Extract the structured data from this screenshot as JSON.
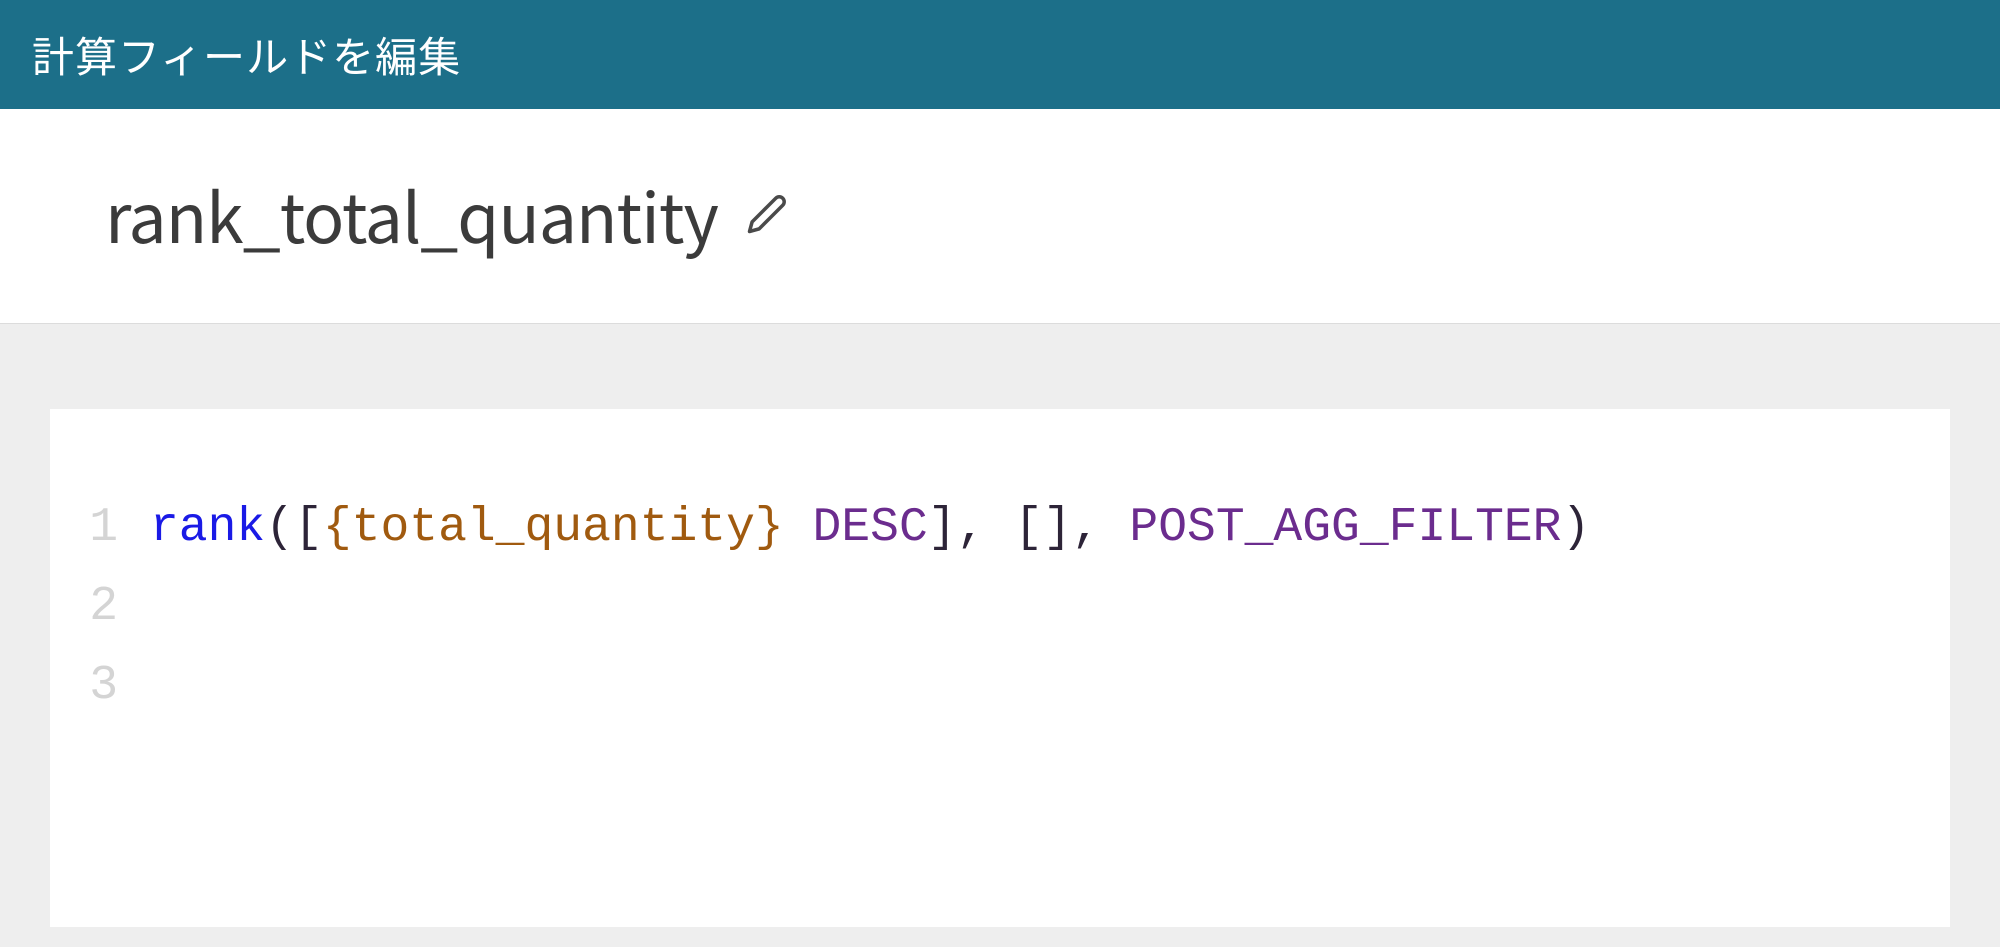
{
  "header": {
    "title": "計算フィールドを編集"
  },
  "field": {
    "name": "rank_total_quantity"
  },
  "editor": {
    "lines": [
      {
        "num": "1"
      },
      {
        "num": "2"
      },
      {
        "num": "3"
      }
    ],
    "code": {
      "func": "rank",
      "open_paren": "(",
      "open_bracket1": "[",
      "field_ref": "{total_quantity}",
      "space1": " ",
      "keyword1": "DESC",
      "close_bracket1": "]",
      "comma1": ", ",
      "open_bracket2": "[",
      "close_bracket2": "]",
      "comma2": ", ",
      "keyword2": "POST_AGG_FILTER",
      "close_paren": ")"
    }
  }
}
